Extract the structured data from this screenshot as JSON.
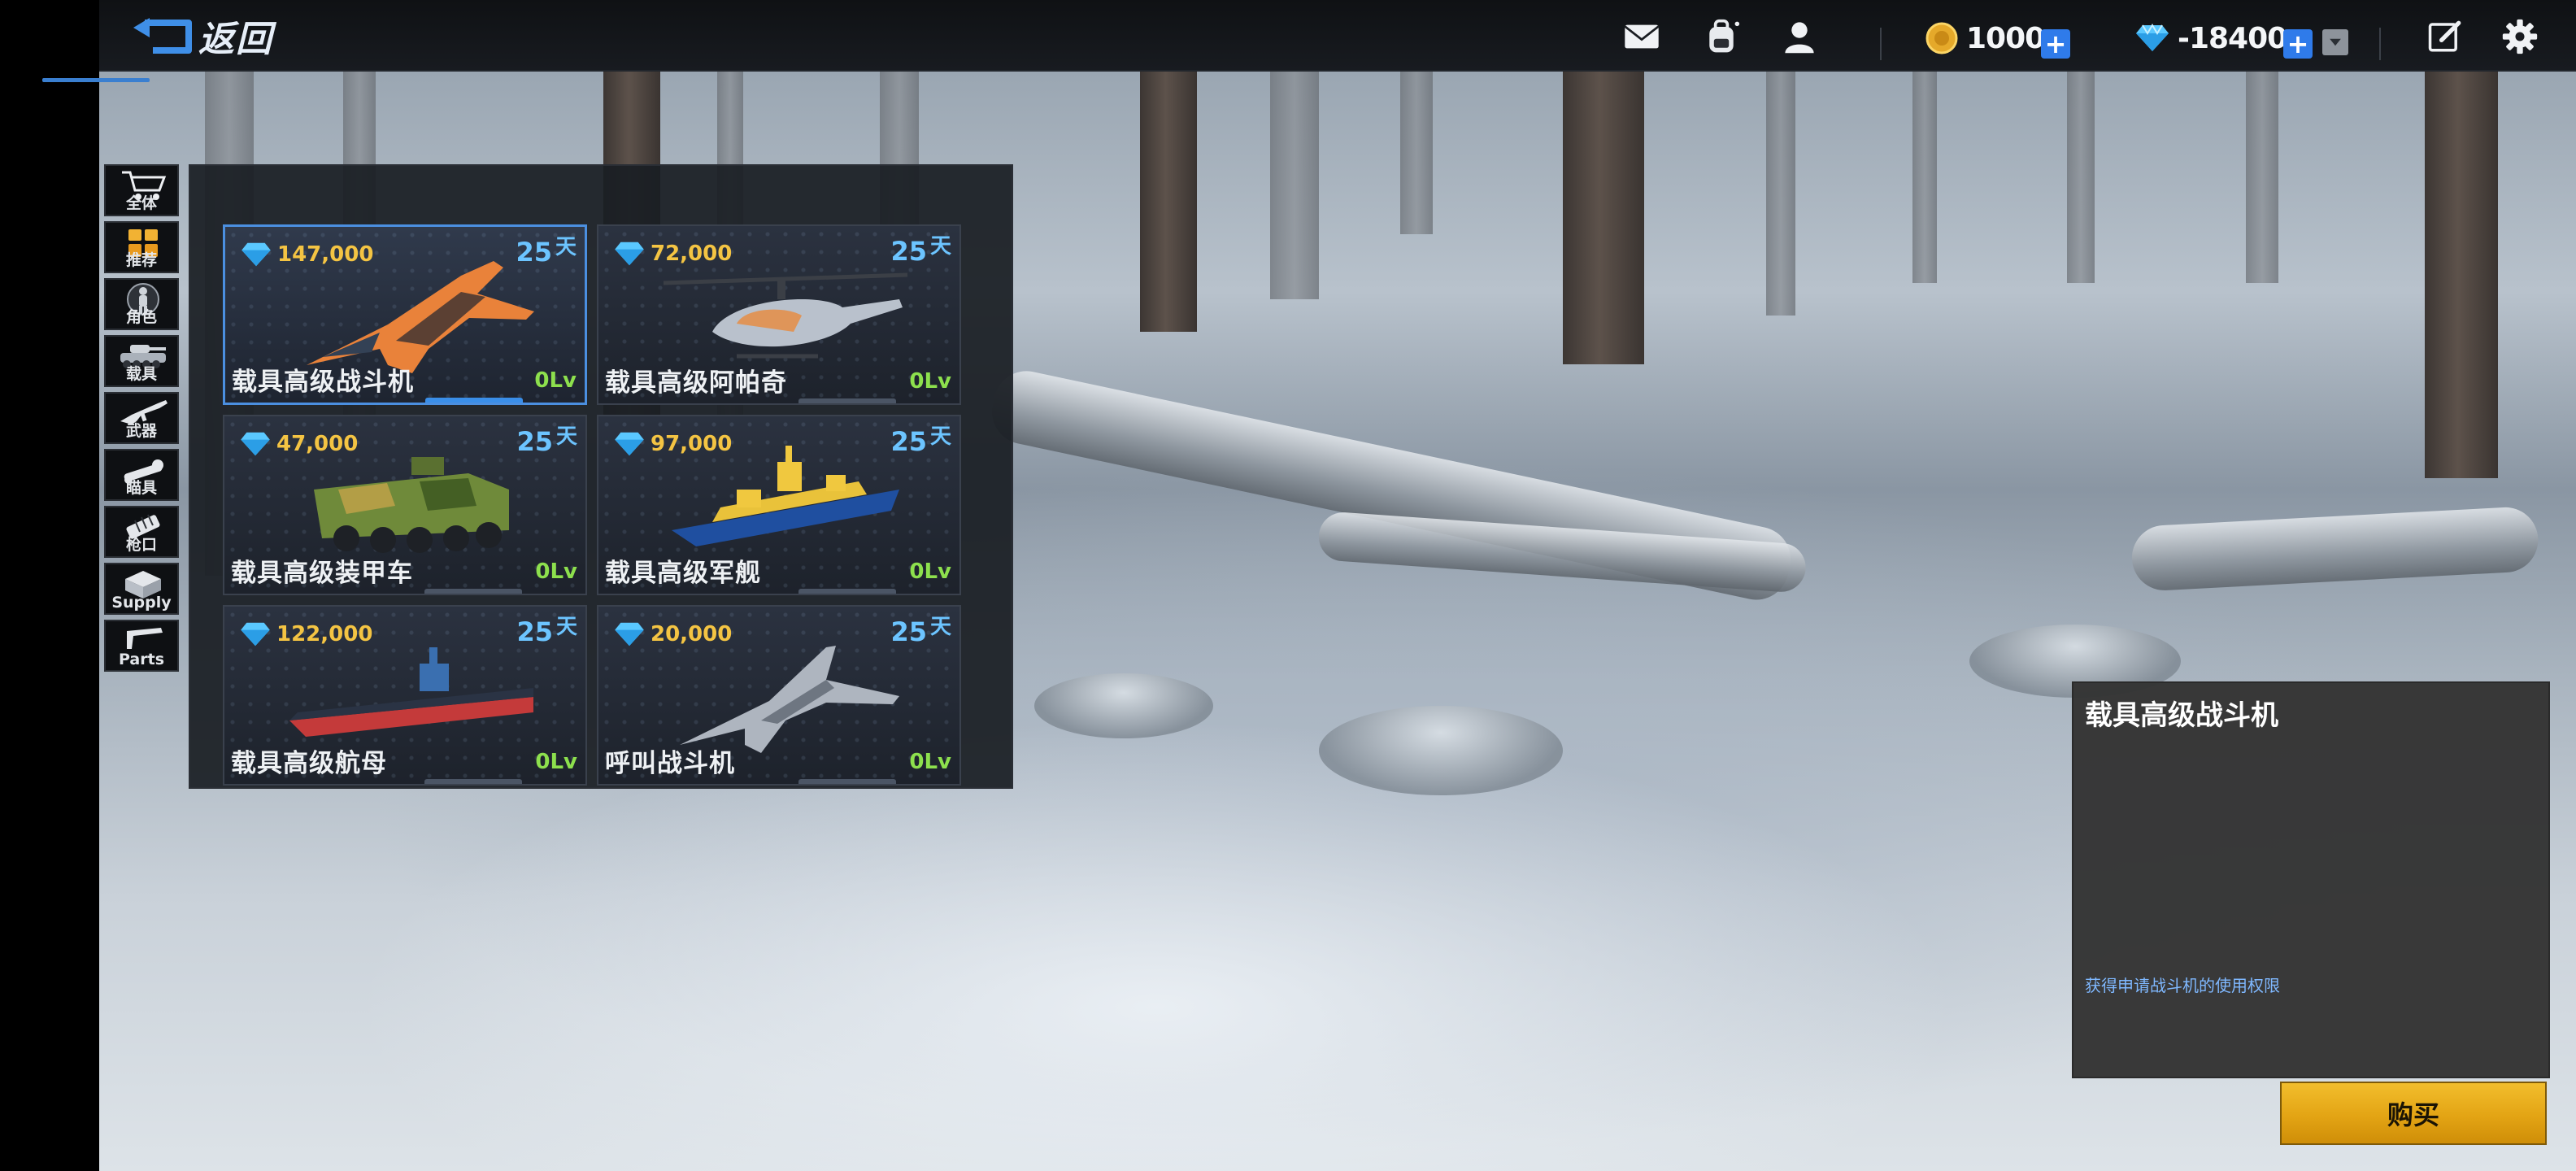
{
  "header": {
    "back_label": "返回",
    "coins": {
      "value": "1000",
      "plus": "+"
    },
    "diamonds": {
      "value": "-18400",
      "plus": "+"
    }
  },
  "sidebar": {
    "items": [
      {
        "id": "all",
        "label": "全体",
        "icon": "shopping-cart-icon"
      },
      {
        "id": "recommend",
        "label": "推荐",
        "icon": "gift-boxes-icon"
      },
      {
        "id": "character",
        "label": "角色",
        "icon": "soldier-icon"
      },
      {
        "id": "vehicle",
        "label": "载具",
        "icon": "tank-icon"
      },
      {
        "id": "weapon",
        "label": "武器",
        "icon": "rifle-icon"
      },
      {
        "id": "scope",
        "label": "瞄具",
        "icon": "scope-icon"
      },
      {
        "id": "muzzle",
        "label": "枪口",
        "icon": "muzzle-icon"
      },
      {
        "id": "supply",
        "label": "Supply",
        "icon": "supply-crate-icon"
      },
      {
        "id": "parts",
        "label": "Parts",
        "icon": "gun-part-icon"
      }
    ]
  },
  "shop": {
    "items": [
      {
        "name": "载具高级战斗机",
        "price": "147,000",
        "days": "25",
        "unit": "天",
        "level": "0Lv",
        "art": "orange-fighter-jet"
      },
      {
        "name": "载具高级阿帕奇",
        "price": "72,000",
        "days": "25",
        "unit": "天",
        "level": "0Lv",
        "art": "apache-helicopter"
      },
      {
        "name": "载具高级装甲车",
        "price": "47,000",
        "days": "25",
        "unit": "天",
        "level": "0Lv",
        "art": "camo-armored-car"
      },
      {
        "name": "载具高级军舰",
        "price": "97,000",
        "days": "25",
        "unit": "天",
        "level": "0Lv",
        "art": "yellow-warship"
      },
      {
        "name": "载具高级航母",
        "price": "122,000",
        "days": "25",
        "unit": "天",
        "level": "0Lv",
        "art": "aircraft-carrier"
      },
      {
        "name": "呼叫战斗机",
        "price": "20,000",
        "days": "25",
        "unit": "天",
        "level": "0Lv",
        "art": "grey-fighter-jet"
      }
    ]
  },
  "detail": {
    "title": "载具高级战斗机",
    "description": "获得申请战斗机的使用权限"
  },
  "buy": {
    "label": "购买"
  },
  "colors": {
    "accent": "#2f7bea",
    "price": "#f4c443",
    "days": "#6cc4ff",
    "level": "#8de04d",
    "buy": "#e3a414"
  }
}
